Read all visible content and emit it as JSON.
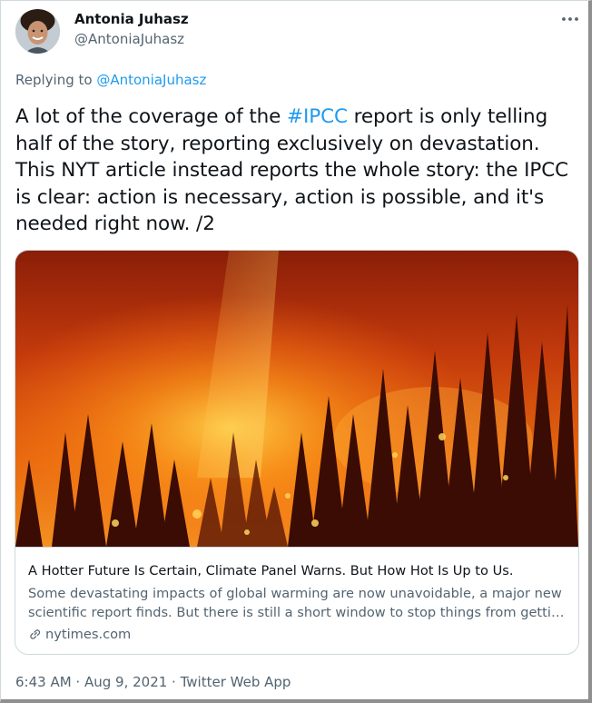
{
  "tweet": {
    "author_name": "Antonia Juhasz",
    "author_handle": "@AntoniaJuhasz",
    "more_icon": "ellipsis-icon",
    "replying_prefix": "Replying to ",
    "replying_to": "@AntoniaJuhasz",
    "text_before_tag": "A lot of the coverage of the ",
    "hashtag": "#IPCC",
    "text_after_tag": " report is only telling half of the story, reporting exclusively on devastation. This NYT article instead reports the whole story: the IPCC is clear: action is necessary, action is possible, and it's needed right now. /2",
    "link_color": "#1d9bf0"
  },
  "card": {
    "image_alt": "forest-fire-photo",
    "title": "A Hotter Future Is Certain, Climate Panel Warns. But How Hot Is Up to Us.",
    "description_line1": "Some devastating impacts of global warming are now unavoidable, a major new",
    "description_line2": "scientific report finds. But there is still a short window to stop things from gettin...",
    "domain": "nytimes.com",
    "domain_icon": "link-icon"
  },
  "footer": {
    "time": "6:43 AM",
    "separator1": " · ",
    "date": "Aug 9, 2021",
    "separator2": " · ",
    "source": "Twitter Web App"
  }
}
